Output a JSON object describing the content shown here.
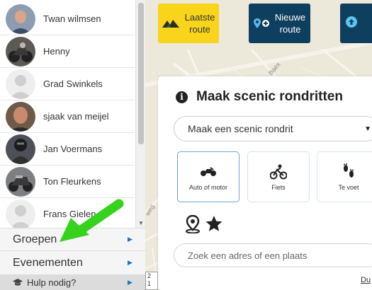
{
  "friends": [
    {
      "name": "Twan wilmsen"
    },
    {
      "name": "Henny"
    },
    {
      "name": "Grad Swinkels"
    },
    {
      "name": "sjaak van meijel"
    },
    {
      "name": "Jan Voermans"
    },
    {
      "name": "Ton Fleurkens"
    },
    {
      "name": "Frans Gielen"
    }
  ],
  "menu": {
    "groups": "Groepen",
    "events": "Evenementen",
    "help": "Hulp nodig?"
  },
  "toolbar": {
    "last_route": "Laatste\nroute",
    "new_route": "Nieuwe\nroute"
  },
  "map": {
    "road_label": "Baex",
    "road_label_left": "weg",
    "scale_text": "2\n1"
  },
  "panel": {
    "title": "Maak scenic rondritten",
    "select_value": "Maak een scenic rondrit",
    "modes": [
      {
        "label": "Auto of motor",
        "icon": "motorcycle-icon",
        "selected": true
      },
      {
        "label": "Fiets",
        "icon": "bicycle-icon",
        "selected": false
      },
      {
        "label": "Te voet",
        "icon": "footsteps-icon",
        "selected": false
      }
    ],
    "search_placeholder": "Zoek een adres of een plaats",
    "bottom_link": "Du"
  },
  "colors": {
    "yellow_button": "#f8d51b",
    "navy_button": "#0f3f5e",
    "arrow_green": "#37d21e",
    "selected_border": "#6aa7d8"
  }
}
